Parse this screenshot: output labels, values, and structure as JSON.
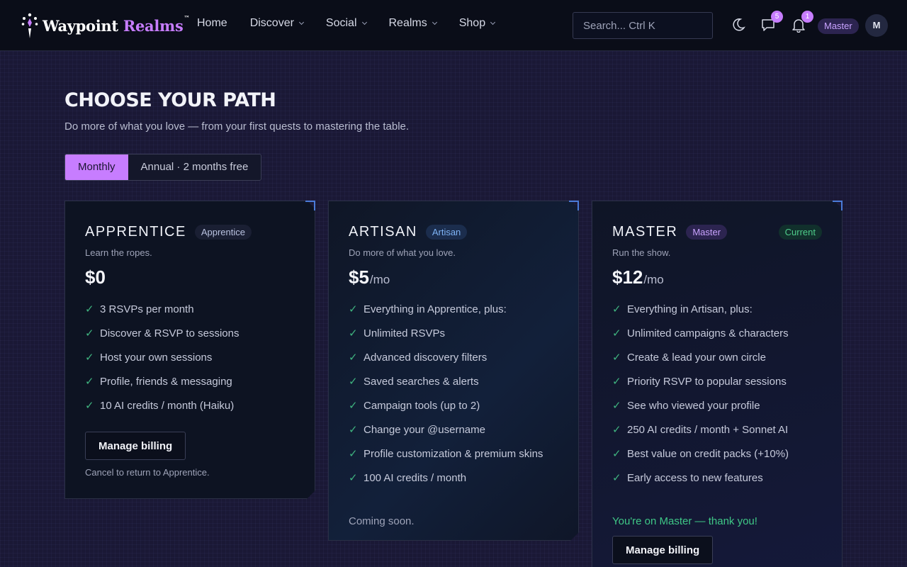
{
  "brand": {
    "name_main": "Waypoint",
    "name_accent": "Realms",
    "tm": "™"
  },
  "nav": {
    "links": [
      {
        "label": "Home",
        "dropdown": false
      },
      {
        "label": "Discover",
        "dropdown": true
      },
      {
        "label": "Social",
        "dropdown": true
      },
      {
        "label": "Realms",
        "dropdown": true
      },
      {
        "label": "Shop",
        "dropdown": true
      }
    ],
    "search_placeholder": "Search... Ctrl K",
    "messages_count": "5",
    "notifications_count": "1",
    "tier": "Master",
    "avatar_initial": "M"
  },
  "page": {
    "title": "CHOOSE YOUR PATH",
    "subtitle": "Do more of what you love — from your first quests to mastering the table."
  },
  "billing_toggle": {
    "monthly": "Monthly",
    "annual": "Annual · 2 months free",
    "selected": "Monthly"
  },
  "plans": [
    {
      "name": "APPRENTICE",
      "tag": "Apprentice",
      "desc": "Learn the ropes.",
      "price": "$0",
      "per": "",
      "features": [
        "3 RSVPs per month",
        "Discover & RSVP to sessions",
        "Host your own sessions",
        "Profile, friends & messaging",
        "10 AI credits / month (Haiku)"
      ],
      "button": "Manage billing",
      "note": "Cancel to return to Apprentice."
    },
    {
      "name": "ARTISAN",
      "tag": "Artisan",
      "desc": "Do more of what you love.",
      "price": "$5",
      "per": "/mo",
      "features": [
        "Everything in Apprentice, plus:",
        "Unlimited RSVPs",
        "Advanced discovery filters",
        "Saved searches & alerts",
        "Campaign tools (up to 2)",
        "Change your @username",
        "Profile customization & premium skins",
        "100 AI credits / month"
      ],
      "note": "Coming soon."
    },
    {
      "name": "MASTER",
      "tag": "Master",
      "current": "Current",
      "desc": "Run the show.",
      "price": "$12",
      "per": "/mo",
      "features": [
        "Everything in Artisan, plus:",
        "Unlimited campaigns & characters",
        "Create & lead your own circle",
        "Priority RSVP to popular sessions",
        "See who viewed your profile",
        "250 AI credits / month + Sonnet AI",
        "Best value on credit packs (+10%)",
        "Early access to new features"
      ],
      "note": "You're on Master — thank you!",
      "button": "Manage billing"
    }
  ],
  "colors": {
    "accent": "#c77dff",
    "check": "#3fb37f",
    "success": "#3fc786",
    "corner": "#4a7bd8"
  }
}
